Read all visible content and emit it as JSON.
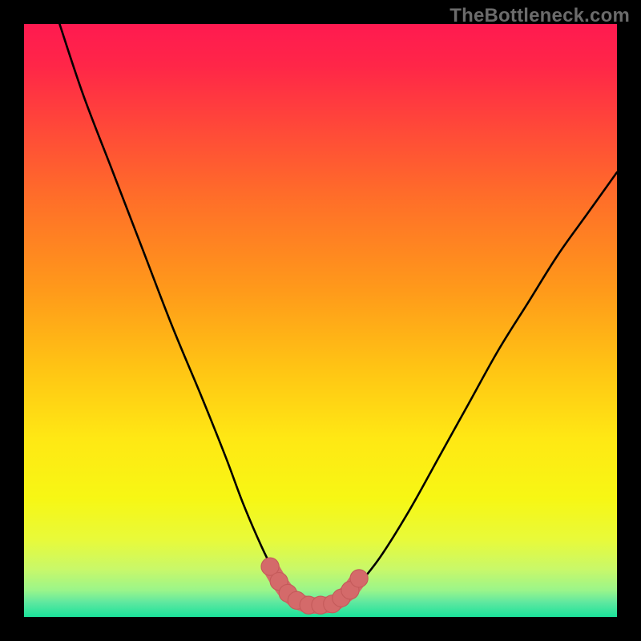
{
  "watermark": "TheBottleneck.com",
  "colors": {
    "frame": "#000000",
    "gradient_stops": [
      {
        "offset": 0.0,
        "color": "#ff1a50"
      },
      {
        "offset": 0.07,
        "color": "#ff2648"
      },
      {
        "offset": 0.18,
        "color": "#ff4a38"
      },
      {
        "offset": 0.3,
        "color": "#ff7028"
      },
      {
        "offset": 0.45,
        "color": "#ff9a1a"
      },
      {
        "offset": 0.58,
        "color": "#ffc414"
      },
      {
        "offset": 0.7,
        "color": "#ffe814"
      },
      {
        "offset": 0.8,
        "color": "#f7f714"
      },
      {
        "offset": 0.87,
        "color": "#e8fa3a"
      },
      {
        "offset": 0.92,
        "color": "#c8f86a"
      },
      {
        "offset": 0.955,
        "color": "#9af58a"
      },
      {
        "offset": 0.975,
        "color": "#60e8a0"
      },
      {
        "offset": 1.0,
        "color": "#1ae29a"
      }
    ],
    "curve": "#000000",
    "marker_fill": "#d46a6a",
    "marker_stroke": "#c45a5a"
  },
  "chart_data": {
    "type": "line",
    "title": "",
    "xlabel": "",
    "ylabel": "",
    "xlim": [
      0,
      100
    ],
    "ylim": [
      0,
      100
    ],
    "grid": false,
    "series": [
      {
        "name": "bottleneck-curve",
        "x": [
          6,
          10,
          15,
          20,
          25,
          30,
          34,
          37,
          40,
          42,
          44,
          46,
          48,
          52,
          54,
          56,
          60,
          65,
          70,
          75,
          80,
          85,
          90,
          95,
          100
        ],
        "y": [
          100,
          88,
          75,
          62,
          49,
          37,
          27,
          19,
          12,
          8,
          5,
          3,
          2,
          2,
          3,
          5,
          10,
          18,
          27,
          36,
          45,
          53,
          61,
          68,
          75
        ]
      }
    ],
    "markers": {
      "name": "highlight-band",
      "x": [
        41.5,
        43,
        44.5,
        46,
        48,
        50,
        52,
        53.5,
        55,
        56.5
      ],
      "y": [
        8.5,
        6.0,
        4.0,
        2.8,
        2.0,
        2.0,
        2.2,
        3.2,
        4.5,
        6.5
      ]
    }
  }
}
